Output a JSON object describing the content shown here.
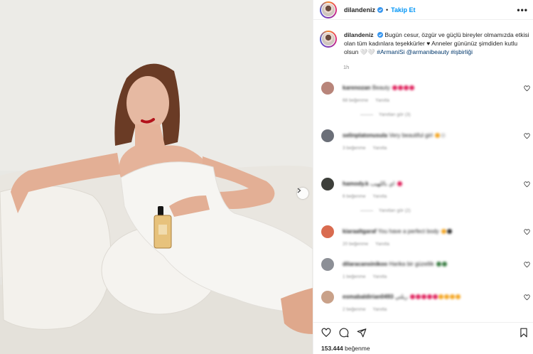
{
  "post": {
    "username": "dilandeniz",
    "follow_label": "Takip Et",
    "more_label": "•••",
    "caption_text": "Bugün cesur, özgür ve güçlü bireyler olmamızda etkisi olan tüm kadınlara teşekkürler ♥ Anneler gününüz şimdiden kutlu olsun 🤍🤍",
    "caption_tags": "#ArmaniSi @armanibeauty #işbirliği",
    "time": "1h",
    "likes_count": "153.444",
    "likes_label": "beğenme"
  },
  "comments": [
    {
      "user": "karenozan",
      "text": "Beauty",
      "likes": "68 beğenme",
      "reply": "Yanıtla",
      "more": "Yanıtları gör (3)",
      "avatar_color": "#b8857a",
      "emoji_colors": [
        "#e0245e",
        "#e0245e",
        "#e0245e",
        "#e0245e"
      ]
    },
    {
      "user": "selinplatonusula",
      "text": "Very beautiful girl",
      "likes": "3 beğenme",
      "reply": "Yanıtla",
      "more": "",
      "avatar_color": "#6b6f78",
      "emoji_colors": [
        "#f4a623",
        "#d9d9d9"
      ]
    },
    {
      "user": "hamody.k",
      "text": "اي باللهيب",
      "likes": "6 beğenme",
      "reply": "Yanıtla",
      "more": "Yanıtları gör (2)",
      "avatar_color": "#3d3f3a",
      "emoji_colors": [
        "#e0245e"
      ]
    },
    {
      "user": "kiaraaltgaraf",
      "text": "You have a perfect body",
      "likes": "20 beğenme",
      "reply": "Yanıtla",
      "more": "",
      "avatar_color": "#d96b4f",
      "emoji_colors": [
        "#f4a623",
        "#333333"
      ]
    },
    {
      "user": "dilaracansinikoo",
      "text": "Harika bir güzellik",
      "likes": "1 beğenme",
      "reply": "Yanıtla",
      "more": "",
      "avatar_color": "#8c8f96",
      "emoji_colors": [
        "#3a7d44",
        "#3a7d44"
      ]
    },
    {
      "user": "esmabaldirian0493",
      "text": "ريلتي",
      "likes": "2 beğenme",
      "reply": "Yanıtla",
      "more": "",
      "avatar_color": "#c9a189",
      "emoji_colors": [
        "#e0245e",
        "#e0245e",
        "#e0245e",
        "#e0245e",
        "#e0245e",
        "#f4a623",
        "#f4a623",
        "#f4a623",
        "#f4a623"
      ]
    }
  ],
  "colors": {
    "accent": "#0095f6",
    "tag": "#00376b",
    "muted": "#8e8e8e",
    "text": "#262626"
  },
  "icons": {
    "like": "heart-icon",
    "comment": "comment-icon",
    "share": "send-icon",
    "save": "bookmark-icon",
    "verified": "verified-badge-icon",
    "next": "chevron-right-icon"
  }
}
